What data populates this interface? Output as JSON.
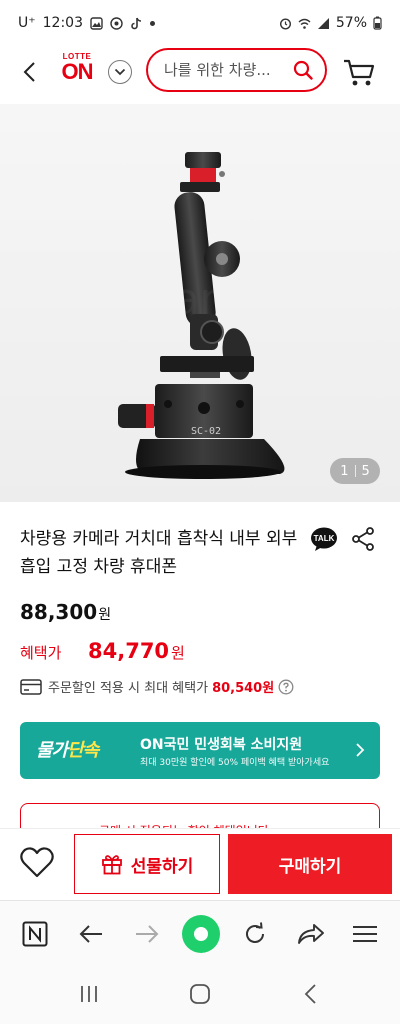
{
  "status_bar": {
    "carrier": "U⁺",
    "time": "12:03",
    "battery": "57%"
  },
  "header": {
    "logo_top": "LOTTE",
    "logo_main": "ON",
    "search_placeholder": "나를 위한 차량..."
  },
  "gallery": {
    "current": "1",
    "total": "5"
  },
  "product": {
    "title": "차량용 카메라 거치대 흡착식 내부 외부 흡입 고정 차량 휴대폰",
    "price": "88,300",
    "price_unit": "원",
    "benefit_label": "혜택가",
    "benefit_price": "84,770",
    "benefit_unit": "원",
    "max_benefit_text": "주문할인 적용 시 최대 혜택가",
    "max_benefit_amount": "80,540원"
  },
  "promo": {
    "badge_a": "물가",
    "badge_b": "단속",
    "title": "ON국민 민생회복 소비지원",
    "subtitle": "최대 30만원 할인에 50% 페이백 혜택 받아가세요"
  },
  "peek_text": "구매 시 적용되는 할인 혜택입니다",
  "actions": {
    "gift_label": "선물하기",
    "buy_label": "구매하기"
  },
  "colors": {
    "brand_red": "#e60012",
    "promo_teal": "#18a89a",
    "browser_green": "#1fcf6b"
  }
}
